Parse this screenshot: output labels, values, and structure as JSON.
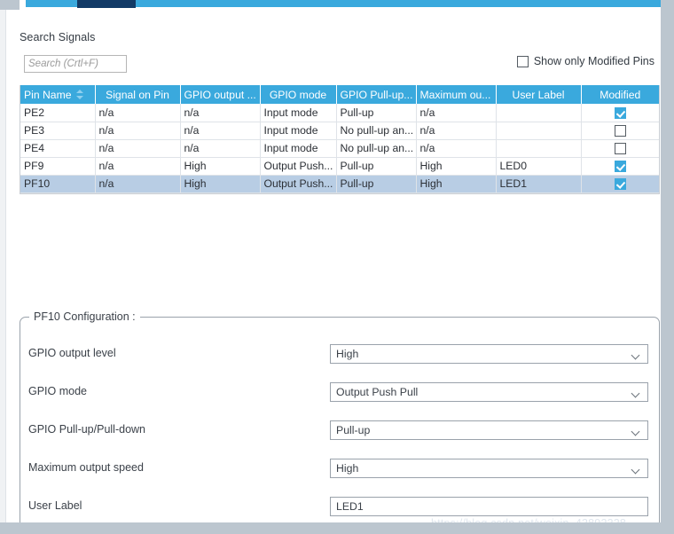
{
  "window": {
    "accent_color": "#3aa9dd",
    "active_tab_color": "#123a66",
    "selection_color": "#b8cde4"
  },
  "search": {
    "label": "Search Signals",
    "placeholder": "Search (Crtl+F)",
    "value": ""
  },
  "filter": {
    "show_only_modified_label": "Show only Modified Pins",
    "show_only_modified_checked": false
  },
  "table": {
    "columns": [
      "Pin Name",
      "Signal on Pin",
      "GPIO output ...",
      "GPIO mode",
      "GPIO Pull-up...",
      "Maximum ou...",
      "User Label",
      "Modified"
    ],
    "sort_column": "Pin Name",
    "rows": [
      {
        "pin_name": "PE2",
        "signal_on_pin": "n/a",
        "gpio_output_level": "n/a",
        "gpio_mode": "Input mode",
        "gpio_pull": "Pull-up",
        "max_output_speed": "n/a",
        "user_label": "",
        "modified": true,
        "selected": false
      },
      {
        "pin_name": "PE3",
        "signal_on_pin": "n/a",
        "gpio_output_level": "n/a",
        "gpio_mode": "Input mode",
        "gpio_pull": "No pull-up an...",
        "max_output_speed": "n/a",
        "user_label": "",
        "modified": false,
        "selected": false
      },
      {
        "pin_name": "PE4",
        "signal_on_pin": "n/a",
        "gpio_output_level": "n/a",
        "gpio_mode": "Input mode",
        "gpio_pull": "No pull-up an...",
        "max_output_speed": "n/a",
        "user_label": "",
        "modified": false,
        "selected": false
      },
      {
        "pin_name": "PF9",
        "signal_on_pin": "n/a",
        "gpio_output_level": "High",
        "gpio_mode": "Output Push...",
        "gpio_pull": "Pull-up",
        "max_output_speed": "High",
        "user_label": "LED0",
        "modified": true,
        "selected": false
      },
      {
        "pin_name": "PF10",
        "signal_on_pin": "n/a",
        "gpio_output_level": "High",
        "gpio_mode": "Output Push...",
        "gpio_pull": "Pull-up",
        "max_output_speed": "High",
        "user_label": "LED1",
        "modified": true,
        "selected": true
      }
    ]
  },
  "config": {
    "legend": "PF10 Configuration :",
    "fields": [
      {
        "label": "GPIO output level",
        "value": "High",
        "kind": "dropdown"
      },
      {
        "label": "GPIO mode",
        "value": "Output Push Pull",
        "kind": "dropdown"
      },
      {
        "label": "GPIO Pull-up/Pull-down",
        "value": "Pull-up",
        "kind": "dropdown"
      },
      {
        "label": "Maximum output speed",
        "value": "High",
        "kind": "dropdown"
      },
      {
        "label": "User Label",
        "value": "LED1",
        "kind": "text"
      }
    ]
  },
  "watermark": {
    "text": "https://blog.csdn.net/weixin_43892328"
  }
}
